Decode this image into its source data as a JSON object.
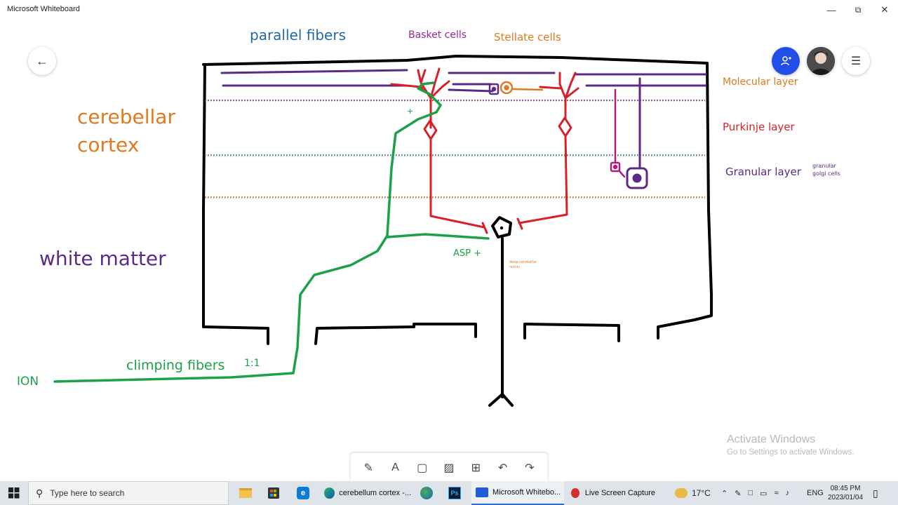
{
  "window": {
    "title": "Microsoft Whiteboard",
    "minimize": "—",
    "maximize": "⧉",
    "close": "✕"
  },
  "nav": {
    "back_icon": "arrow-left-icon"
  },
  "header_right": {
    "share_icon": "add-person-icon",
    "avatar": "user-avatar",
    "menu_icon": "hamburger-menu-icon"
  },
  "whiteboard": {
    "labels": {
      "parallel_fibers": "parallel fibers",
      "basket_cells": "Basket cells",
      "stellate_cells": "Stellate cells",
      "cerebellar": "cerebellar",
      "cortex": "cortex",
      "white_matter": "white matter",
      "molecular_layer": "Molecular layer",
      "purkinje_layer": "Purkinje layer",
      "granular_layer": "Granular layer",
      "granular_small": "granular",
      "golgi_cells": "golgi cells",
      "asp": "ASP +",
      "plus": "+",
      "deep_nuclei_1": "deep cerebellar",
      "deep_nuclei_2": "nuclei",
      "climbing_fibers": "climping fibers",
      "ratio": "1:1",
      "ion": "ION"
    },
    "colors": {
      "black": "#000000",
      "red": "#d8202a",
      "green": "#1ca14a",
      "purple": "#5b2a86",
      "magenta": "#b01d7f",
      "orange": "#e07a1f",
      "blue": "#1f6aa6",
      "teal": "#1b9bb0"
    }
  },
  "toolbar": {
    "tools": [
      "pen-icon",
      "text-icon",
      "sticky-note-icon",
      "image-icon",
      "insert-icon",
      "undo-icon",
      "redo-icon"
    ],
    "pen": "✎",
    "text": "A",
    "note": "▢",
    "image": "▨",
    "insert": "⊞",
    "undo": "↶",
    "redo": "↷"
  },
  "watermark": {
    "line1": "Activate Windows",
    "line2": "Go to Settings to activate Windows."
  },
  "taskbar": {
    "search_placeholder": "Type here to search",
    "apps": [
      {
        "label": "cerebellum cortex -...",
        "icon": "edge-icon"
      },
      {
        "label": "Microsoft Whitebo...",
        "icon": "whiteboard-icon",
        "active": true
      },
      {
        "label": "Live Screen Capture",
        "icon": "record-icon"
      }
    ],
    "weather": "17°C",
    "language": "ENG",
    "time": "08:45 PM",
    "date": "2023/01/04"
  }
}
